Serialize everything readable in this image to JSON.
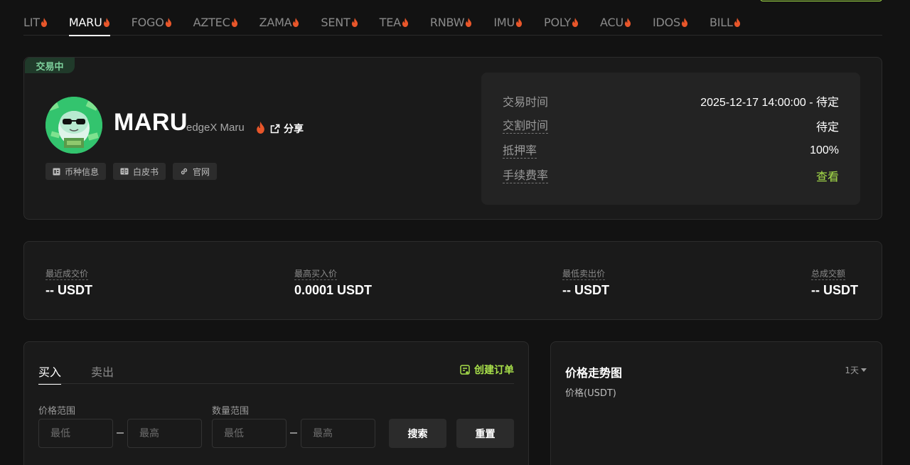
{
  "tabs": [
    {
      "label": "LIT",
      "active": false
    },
    {
      "label": "MARU",
      "active": true
    },
    {
      "label": "FOGO",
      "active": false
    },
    {
      "label": "AZTEC",
      "active": false
    },
    {
      "label": "ZAMA",
      "active": false
    },
    {
      "label": "SENT",
      "active": false
    },
    {
      "label": "TEA",
      "active": false
    },
    {
      "label": "RNBW",
      "active": false
    },
    {
      "label": "IMU",
      "active": false
    },
    {
      "label": "POLY",
      "active": false
    },
    {
      "label": "ACU",
      "active": false
    },
    {
      "label": "IDOS",
      "active": false
    },
    {
      "label": "BILL",
      "active": false
    }
  ],
  "token": {
    "status": "交易中",
    "symbol": "MARU",
    "name": "edgeX Maru",
    "share_label": "分享",
    "chips": [
      {
        "label": "币种信息",
        "icon": "coin-info-icon"
      },
      {
        "label": "白皮书",
        "icon": "book-icon"
      },
      {
        "label": "官网",
        "icon": "link-icon"
      }
    ]
  },
  "info": {
    "rows": [
      {
        "label": "交易时间",
        "value": "2025-12-17 14:00:00 - 待定",
        "dashed": false
      },
      {
        "label": "交割时间",
        "value": "待定",
        "dashed": true
      },
      {
        "label": "抵押率",
        "value": "100%",
        "dashed": true
      },
      {
        "label": "手续费率",
        "value": "查看",
        "dashed": true
      }
    ]
  },
  "stats": [
    {
      "label": "最近成交价",
      "value": "-- USDT"
    },
    {
      "label": "最高买入价",
      "value": "0.0001 USDT"
    },
    {
      "label": "最低卖出价",
      "value": "-- USDT"
    },
    {
      "label": "总成交额",
      "value": "-- USDT"
    }
  ],
  "orders": {
    "tab_buy": "买入",
    "tab_sell": "卖出",
    "create_label": "创建订单",
    "price_range_label": "价格范围",
    "qty_range_label": "数量范围",
    "min_placeholder": "最低",
    "max_placeholder": "最高",
    "search_label": "搜索",
    "reset_label": "重置"
  },
  "chart": {
    "title": "价格走势图",
    "ylabel": "价格(USDT)",
    "range": "1天"
  },
  "colors": {
    "accent": "#a8e04a",
    "flame": "#e8562a",
    "status_bg": "#203a2a",
    "status_text": "#7ed19d"
  }
}
